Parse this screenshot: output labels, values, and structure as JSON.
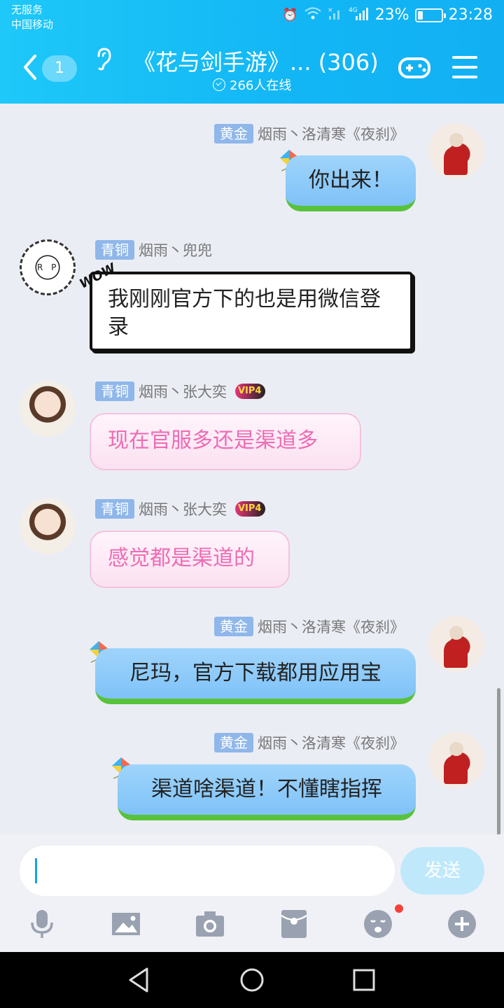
{
  "status_bar": {
    "carrier_line1": "无服务",
    "carrier_line2": "中国移动",
    "network": "4G",
    "battery": "23%",
    "battery_level": 0.23,
    "time": "23:28"
  },
  "header": {
    "unread_count": "1",
    "title": "《花与剑手游》... (306)",
    "online": "266人在线"
  },
  "messages": [
    {
      "side": "right",
      "tag": "黄金",
      "sender": "烟雨丶洛清寒《夜刹》",
      "text": "你出来！",
      "style": "blue"
    },
    {
      "side": "left",
      "tag": "青铜",
      "sender": "烟雨丶兜兜",
      "text": "我刚刚官方下的也是用微信登录",
      "style": "comic",
      "sticker": "WOW",
      "avatar_text": "R P"
    },
    {
      "side": "left",
      "tag": "青铜",
      "sender": "烟雨丶张大奕",
      "vip": "VIP4",
      "text": "现在官服多还是渠道多",
      "style": "pink"
    },
    {
      "side": "left",
      "tag": "青铜",
      "sender": "烟雨丶张大奕",
      "vip": "VIP4",
      "text": "感觉都是渠道的",
      "style": "pink"
    },
    {
      "side": "right",
      "tag": "黄金",
      "sender": "烟雨丶洛清寒《夜刹》",
      "text": "尼玛，官方下载都用应用宝",
      "style": "blue"
    },
    {
      "side": "right",
      "tag": "黄金",
      "sender": "烟雨丶洛清寒《夜刹》",
      "text": "渠道啥渠道！不懂瞎指挥",
      "style": "blue"
    }
  ],
  "input": {
    "value": "",
    "send_label": "发送"
  },
  "toolbar": [
    "microphone-icon",
    "image-icon",
    "camera-icon",
    "red-packet-icon",
    "emoji-icon",
    "plus-icon"
  ],
  "colors": {
    "header": "#1ec8f8",
    "bubble_blue": "#8fcbf9",
    "bubble_pink_text": "#ee6cb4",
    "tag_bg": "#8fb7ea",
    "send_disabled": "#bfe9fb"
  }
}
